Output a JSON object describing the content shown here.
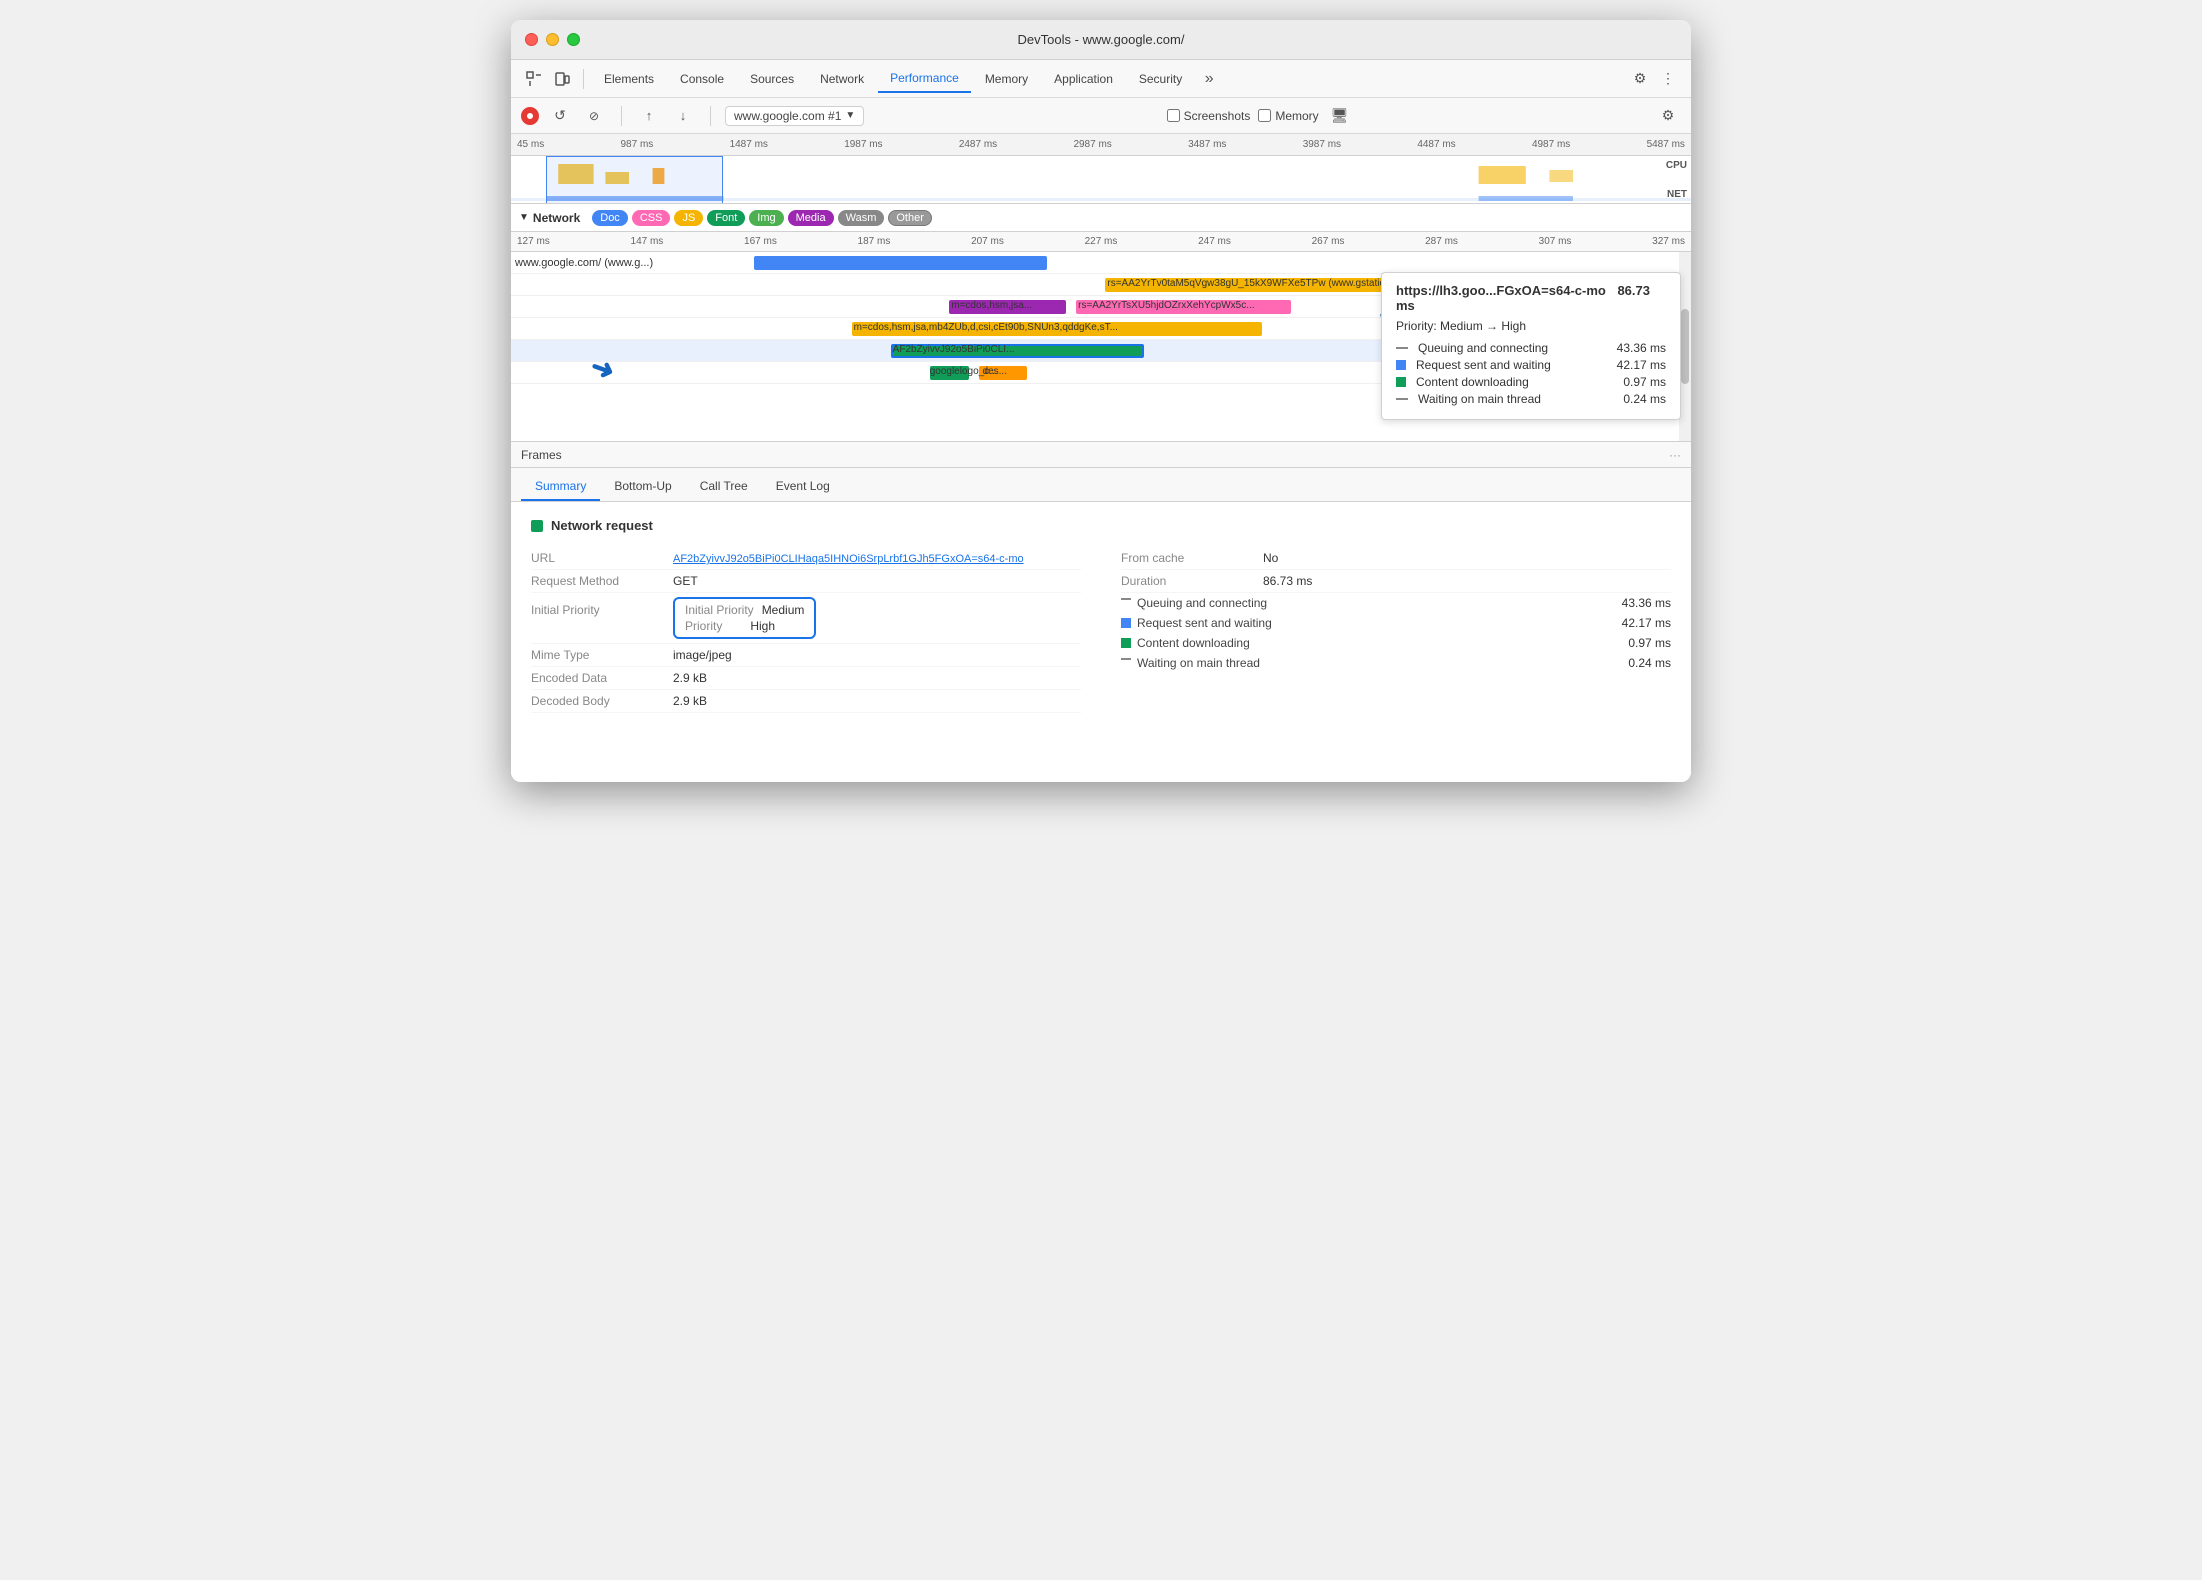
{
  "window": {
    "title": "DevTools - www.google.com/"
  },
  "tabs": [
    {
      "label": "Elements",
      "active": false
    },
    {
      "label": "Console",
      "active": false
    },
    {
      "label": "Sources",
      "active": false
    },
    {
      "label": "Network",
      "active": false
    },
    {
      "label": "Performance",
      "active": true
    },
    {
      "label": "Memory",
      "active": false
    },
    {
      "label": "Application",
      "active": false
    },
    {
      "label": "Security",
      "active": false
    }
  ],
  "record_bar": {
    "url": "www.google.com #1",
    "screenshots_label": "Screenshots",
    "memory_label": "Memory"
  },
  "timeline_ruler": {
    "marks": [
      "45 ms",
      "987 ms",
      "1487 ms",
      "1987 ms",
      "2487 ms",
      "2987 ms",
      "3487 ms",
      "3987 ms",
      "4487 ms",
      "4987 ms",
      "5487 ms"
    ]
  },
  "labels": {
    "cpu": "CPU",
    "net": "NET"
  },
  "network_filter": {
    "label": "Network",
    "chips": [
      "Doc",
      "CSS",
      "JS",
      "Font",
      "Img",
      "Media",
      "Wasm",
      "Other"
    ]
  },
  "ms_ruler": {
    "marks": [
      "127 ms",
      "147 ms",
      "167 ms",
      "187 ms",
      "207 ms",
      "227 ms",
      "247 ms",
      "267 ms",
      "287 ms",
      "307 ms",
      "327 ms"
    ]
  },
  "waterfall": {
    "rows": [
      {
        "label": "www.google.com/ (www.g...",
        "type": "doc"
      },
      {
        "label": "rs=AA2YrTv0taM5qVgw38gU_15kX9WFXe5TPw (www.gstatic.com)",
        "type": "js"
      },
      {
        "label": "m=cdos,hsm,jsa...",
        "type": "js"
      },
      {
        "label": "rs=AA2YrTsXU5hjdOZrxXehYcpWx5c...",
        "type": "js"
      },
      {
        "label": "m=cdos,hsm,jsa,mb4ZUb,d,csi,cEt90b,SNUn3,qddgKe,sT...",
        "type": "js"
      },
      {
        "label": "AF2bZyivvJ92o5BiPi0CLIHaqa5IHNOi6SrpLrbf1GJh5FGxOA=s64-c-mo",
        "type": "img"
      },
      {
        "label": "googlelogo_c...",
        "type": "img"
      },
      {
        "label": "des...",
        "type": "img"
      }
    ]
  },
  "tooltip": {
    "title": "https://lh3.goo...FGxOA=s64-c-mo",
    "duration": "86.73 ms",
    "priority_change": "Priority: Medium → High",
    "rows": [
      {
        "label": "Queuing and connecting",
        "value": "43.36 ms",
        "icon": "line"
      },
      {
        "label": "Request sent and waiting",
        "value": "42.17 ms",
        "icon": "square"
      },
      {
        "label": "Content downloading",
        "value": "0.97 ms",
        "icon": "square"
      },
      {
        "label": "Waiting on main thread",
        "value": "0.24 ms",
        "icon": "line"
      }
    ]
  },
  "frames_label": "Frames",
  "bottom_tabs": [
    {
      "label": "Summary",
      "active": true
    },
    {
      "label": "Bottom-Up",
      "active": false
    },
    {
      "label": "Call Tree",
      "active": false
    },
    {
      "label": "Event Log",
      "active": false
    }
  ],
  "summary": {
    "section_title": "Network request",
    "left": [
      {
        "label": "URL",
        "value": "AF2bZyivvJ92o5BiPi0CLIHaqa5IHNOi6SrpLrbf1GJh5FGxOA=s64-c-mo",
        "is_link": true
      },
      {
        "label": "Request Method",
        "value": "GET"
      },
      {
        "label": "Initial Priority",
        "value": "Medium"
      },
      {
        "label": "Priority",
        "value": "High"
      },
      {
        "label": "Mime Type",
        "value": "image/jpeg"
      },
      {
        "label": "Encoded Data",
        "value": "2.9 kB"
      },
      {
        "label": "Decoded Body",
        "value": "2.9 kB"
      }
    ],
    "right": [
      {
        "label": "From cache",
        "value": "No"
      },
      {
        "label": "Duration",
        "value": "86.73 ms"
      },
      {
        "label": "Queuing and connecting",
        "value": "43.36 ms"
      },
      {
        "label": "Request sent and waiting",
        "value": "42.17 ms"
      },
      {
        "label": "Content downloading",
        "value": "0.97 ms"
      },
      {
        "label": "Waiting on main thread",
        "value": "0.24 ms"
      }
    ]
  }
}
